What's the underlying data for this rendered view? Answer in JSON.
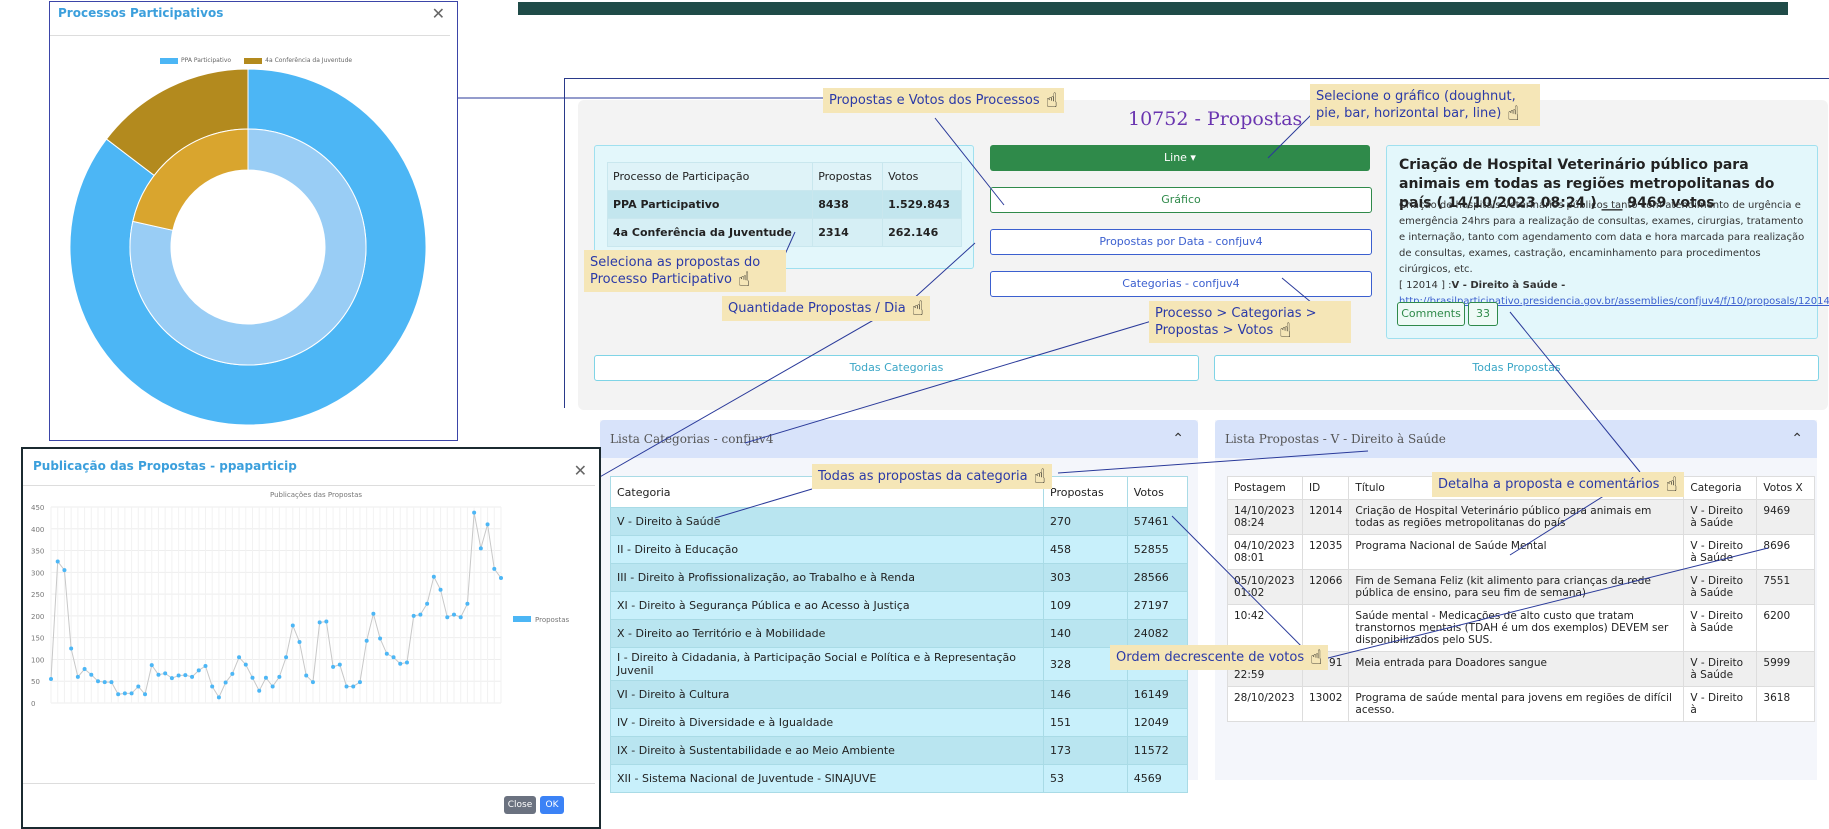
{
  "top_panel": {
    "title": "10752 - Propostas",
    "process_table": {
      "headers": [
        "Processo de Participação",
        "Propostas",
        "Votos"
      ],
      "rows": [
        [
          "PPA Participativo",
          "8438",
          "1.529.843"
        ],
        [
          "4a Conferência da Juventude",
          "2314",
          "262.146"
        ]
      ]
    },
    "chart_type_button": "Line ▾",
    "buttons": {
      "grafico": "Gráfico",
      "propostas_por_data": "Propostas por Data - confjuv4",
      "categorias": "Categorias - confjuv4",
      "todas_categorias": "Todas Categorias",
      "todas_propostas": "Todas Propostas"
    },
    "detail": {
      "title": "Criação de Hospital Veterinário público para animais em todas as regiões metropolitanas do país ( 14/10/2023 08:24 ) ___ 9469 votos",
      "text": "Criação de hospitais veterinários públicos tanto com atendimento de urgência e emergência 24hrs para a realização de consultas, exames, cirurgias, tratamento e internação, tanto com agendamento com data e hora marcada para realização de consultas, exames, castração, encaminhamento para procedimentos cirúrgicos, etc.",
      "ref_prefix": "[ 12014 ] :",
      "ref_category": "V - Direito à Saúde -",
      "link": "http://brasilparticipativo.presidencia.gov.br/assemblies/confjuv4/f/10/proposals/12014",
      "comments_label": "Comments",
      "comments_count": "33"
    }
  },
  "categories_panel": {
    "header": "Lista Categorias - confjuv4",
    "headers": [
      "Categoria",
      "Propostas",
      "Votos"
    ],
    "rows": [
      [
        "V - Direito à Saúde",
        "270",
        "57461"
      ],
      [
        "II - Direito à Educação",
        "458",
        "52855"
      ],
      [
        "III - Direito à Profissionalização, ao Trabalho e à Renda",
        "303",
        "28566"
      ],
      [
        "XI - Direito à Segurança Pública e ao Acesso à Justiça",
        "109",
        "27197"
      ],
      [
        "X - Direito ao Território e à Mobilidade",
        "140",
        "24082"
      ],
      [
        "I - Direito à Cidadania, à Participação Social e Política e à Representação Juvenil",
        "328",
        "16590"
      ],
      [
        "VI - Direito à Cultura",
        "146",
        "16149"
      ],
      [
        "IV - Direito à Diversidade e à Igualdade",
        "151",
        "12049"
      ],
      [
        "IX - Direito à Sustentabilidade e ao Meio Ambiente",
        "173",
        "11572"
      ],
      [
        "XII - Sistema Nacional de Juventude - SINAJUVE",
        "53",
        "4569"
      ]
    ]
  },
  "proposals_panel": {
    "header": "Lista Propostas - V - Direito à Saúde",
    "headers": [
      "Postagem",
      "ID",
      "Título",
      "Categoria",
      "Votos X"
    ],
    "rows": [
      [
        "14/10/2023 08:24",
        "12014",
        "Criação de Hospital Veterinário público para animais em todas as regiões metropolitanas do país",
        "V - Direito à Saúde",
        "9469"
      ],
      [
        "04/10/2023 08:01",
        "12035",
        "Programa Nacional de Saúde Mental",
        "V - Direito à Saúde",
        "8696"
      ],
      [
        "05/10/2023 01:02",
        "12066",
        "Fim de Semana Feliz (kit alimento para crianças da rede pública de ensino, para seu fim de semana)",
        "V - Direito à Saúde",
        "7551"
      ],
      [
        "10:42",
        "",
        "Saúde mental - Medicações de alto custo que tratam transtornos mentais (TDAH é um dos exemplos) DEVEM ser disponibilizados pelo SUS.",
        "V - Direito à Saúde",
        "6200"
      ],
      [
        "25/10/2023 22:59",
        "12791",
        "Meia entrada para Doadores sangue",
        "V - Direito à Saúde",
        "5999"
      ],
      [
        "28/10/2023",
        "13002",
        "Programa de saúde mental para jovens em regiões de difícil acesso.",
        "V - Direito à",
        "3618"
      ]
    ]
  },
  "annotations": {
    "a1": "Propostas e Votos dos Processos",
    "a2": "Selecione o gráfico (doughnut, pie, bar, horizontal bar, line)",
    "a3": "Seleciona as propostas do Processo Participativo",
    "a4": "Quantidade Propostas / Dia",
    "a5": "Processo > Categorias > Propostas > Votos",
    "a6": "Todas as propostas da categoria",
    "a7": "Detalha a proposta e comentários",
    "a8": "Ordem decrescente de votos"
  },
  "doughnut_dialog": {
    "title": "Processos Participativos",
    "legend": [
      "PPA Participativo",
      "4a Conferência da Juventude"
    ],
    "colors": [
      "#4cb6f5",
      "#b38a1e"
    ],
    "inner_colors": [
      "#99cdf5",
      "#d9a52e"
    ]
  },
  "line_dialog": {
    "title": "Publicação das Propostas - ppaparticip",
    "chart_title": "Publicações das Propostas",
    "legend": "Propostas",
    "close_label": "Close",
    "ok_label": "OK"
  },
  "chart_data": [
    {
      "type": "pie",
      "title": "Processos Participativos",
      "categories": [
        "PPA Participativo",
        "4a Conferência da Juventude"
      ],
      "series": [
        {
          "values": [
            1529843,
            262146
          ]
        },
        {
          "values": [
            8438,
            2314
          ]
        }
      ]
    },
    {
      "type": "line",
      "title": "Publicações das Propostas",
      "ylim": [
        0,
        450
      ],
      "yticks": [
        0,
        50,
        100,
        150,
        200,
        250,
        300,
        350,
        400,
        450
      ],
      "series": [
        {
          "name": "Propostas",
          "values": [
            55,
            325,
            305,
            125,
            60,
            78,
            65,
            50,
            48,
            48,
            20,
            22,
            22,
            38,
            20,
            87,
            65,
            68,
            57,
            63,
            64,
            60,
            75,
            85,
            38,
            13,
            47,
            67,
            105,
            88,
            58,
            28,
            58,
            38,
            60,
            105,
            178,
            140,
            63,
            48,
            185,
            187,
            83,
            88,
            38,
            38,
            48,
            143,
            205,
            148,
            113,
            105,
            90,
            93,
            200,
            203,
            228,
            290,
            260,
            197,
            203,
            197,
            228,
            437,
            355,
            410,
            308,
            287
          ]
        }
      ]
    }
  ]
}
